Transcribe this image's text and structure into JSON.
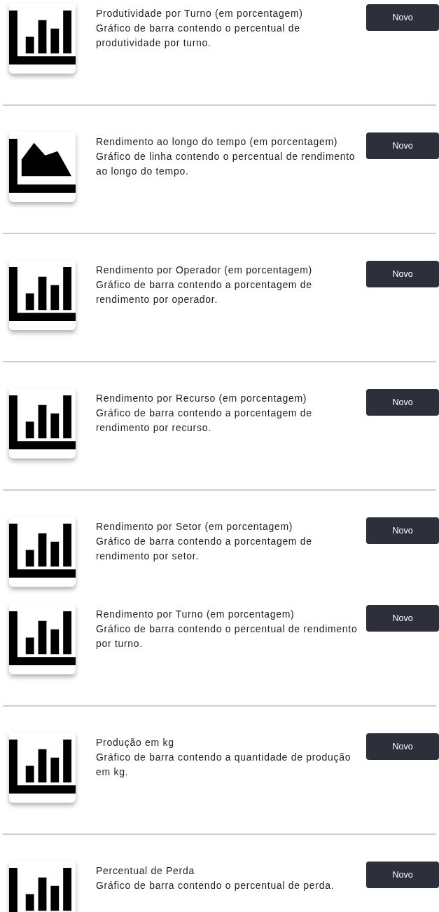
{
  "charts": [
    {
      "kind": "bar",
      "title": "Produtividade por Turno (em porcentagem)",
      "description": "Gráfico de barra contendo o percentual de produtividade por turno.",
      "button": "Novo",
      "divider_below": true
    },
    {
      "kind": "area",
      "title": "Rendimento ao longo do tempo (em porcentagem)",
      "description": "Gráfico de linha contendo o percentual de rendimento ao longo do tempo.",
      "button": "Novo",
      "divider_below": true
    },
    {
      "kind": "bar",
      "title": "Rendimento por Operador (em porcentagem)",
      "description": "Gráfico de barra contendo a porcentagem de rendimento por operador.",
      "button": "Novo",
      "divider_below": true
    },
    {
      "kind": "bar",
      "title": "Rendimento por Recurso (em porcentagem)",
      "description": "Gráfico de barra contendo a porcentagem de rendimento por recurso.",
      "button": "Novo",
      "divider_below": true
    },
    {
      "kind": "bar",
      "title": "Rendimento por Setor (em porcentagem)",
      "description": "Gráfico de barra contendo a porcentagem de rendimento por setor.",
      "button": "Novo",
      "divider_below": false
    },
    {
      "kind": "bar",
      "title": "Rendimento por Turno (em porcentagem)",
      "description": "Gráfico de barra contendo o percentual de rendimento por turno.",
      "button": "Novo",
      "divider_below": true
    },
    {
      "kind": "bar",
      "title": "Produção em kg",
      "description": "Gráfico de barra contendo a quantidade de produção em kg.",
      "button": "Novo",
      "divider_below": true
    },
    {
      "kind": "bar",
      "title": "Percentual de Perda",
      "description": "Gráfico de barra contendo o percentual de perda.",
      "button": "Novo",
      "divider_below": false
    }
  ]
}
